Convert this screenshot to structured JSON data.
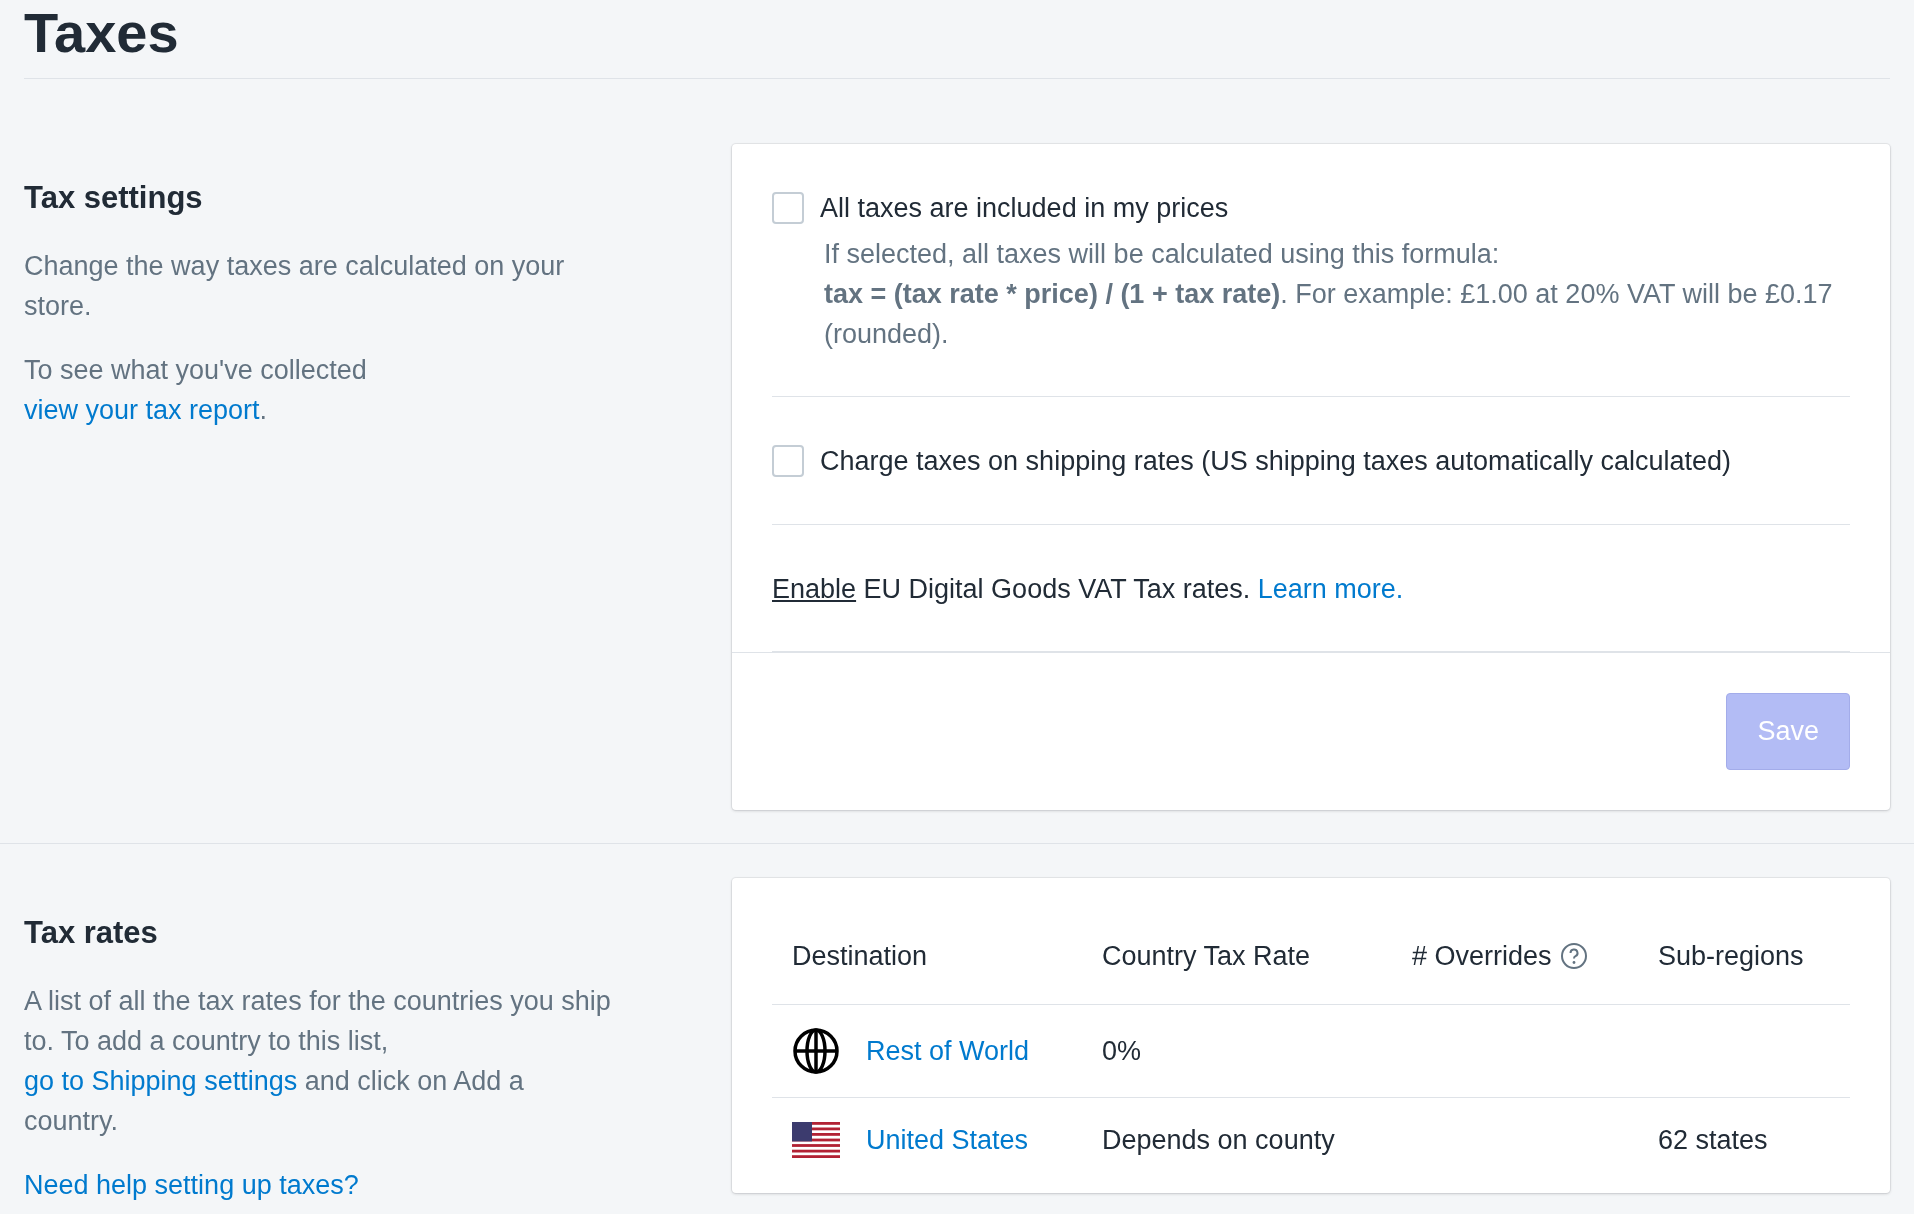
{
  "page": {
    "title": "Taxes"
  },
  "tax_settings": {
    "heading": "Tax settings",
    "description": "Change the way taxes are calculated on your store.",
    "report": {
      "text": "To see what you've collected",
      "link": "view your tax report",
      "end": "."
    },
    "options": [
      {
        "kind": "checkbox",
        "label": "All taxes are included in my prices",
        "checked": false,
        "help_lines": [
          "If selected, all taxes will be calculated using this formula:",
          "**tax = (tax rate * price) / (1 + tax rate)**. For example: £1.00 at 20% VAT will be £0.17 (rounded)."
        ]
      },
      {
        "kind": "checkbox",
        "label": "Charge taxes on shipping rates (US shipping taxes automatically calculated)",
        "checked": false
      },
      {
        "kind": "notice",
        "action": "Enable",
        "text": "EU Digital Goods VAT Tax rates.",
        "link": "Learn more."
      }
    ],
    "save": {
      "label": "Save",
      "disabled": true
    }
  },
  "tax_rates": {
    "heading": "Tax rates",
    "description": {
      "text": "A list of all the tax rates for the countries you ship to. To add a country to this list,",
      "link": "go to Shipping settings",
      "end": "and click on Add a country."
    },
    "help_link": "Need help setting up taxes?",
    "table": {
      "columns": [
        {
          "label": "Destination",
          "help": false
        },
        {
          "label": "Country Tax Rate",
          "help": false
        },
        {
          "label": "# Overrides",
          "help": true
        },
        {
          "label": "Sub-regions",
          "help": false
        }
      ],
      "rows": [
        {
          "kind": "world",
          "destination": "Rest of World",
          "rate": "0%"
        },
        {
          "kind": "country",
          "destination": "United States",
          "rate": "Depends on county",
          "subregions": "62 states"
        }
      ]
    }
  }
}
